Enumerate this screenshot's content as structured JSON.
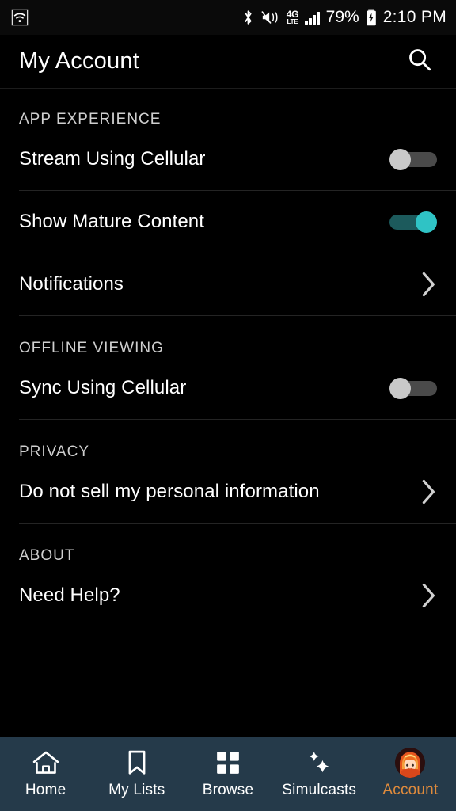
{
  "statusbar": {
    "wifi_icon": "wifi-icon",
    "bluetooth_icon": "bluetooth-icon",
    "mute_vibrate_icon": "speaker-mute-vibrate-icon",
    "network_label_top": "4G",
    "network_label_bottom": "LTE",
    "signal_icon": "signal-bars-icon",
    "battery_percent": "79%",
    "battery_icon": "battery-charging-icon",
    "time": "2:10 PM"
  },
  "header": {
    "title": "My Account",
    "search_icon": "search-icon"
  },
  "sections": [
    {
      "id": "app-experience",
      "title": "APP EXPERIENCE",
      "rows": [
        {
          "id": "stream-using-cellular",
          "label": "Stream Using Cellular",
          "control": "toggle",
          "value": "off",
          "divider": true
        },
        {
          "id": "show-mature-content",
          "label": "Show Mature Content",
          "control": "toggle",
          "value": "on",
          "divider": true
        },
        {
          "id": "notifications",
          "label": "Notifications",
          "control": "chevron",
          "value": "",
          "divider": true
        }
      ]
    },
    {
      "id": "offline-viewing",
      "title": "OFFLINE VIEWING",
      "rows": [
        {
          "id": "sync-using-cellular",
          "label": "Sync Using Cellular",
          "control": "toggle",
          "value": "off",
          "divider": true
        }
      ]
    },
    {
      "id": "privacy",
      "title": "PRIVACY",
      "rows": [
        {
          "id": "do-not-sell-my-personal-information",
          "label": "Do not sell my personal information",
          "control": "chevron",
          "value": "",
          "divider": true
        }
      ]
    },
    {
      "id": "about",
      "title": "ABOUT",
      "rows": [
        {
          "id": "need-help",
          "label": "Need Help?",
          "control": "chevron",
          "value": "",
          "divider": false
        }
      ]
    }
  ],
  "bottomnav": {
    "items": [
      {
        "id": "home",
        "label": "Home",
        "icon": "home-icon",
        "active": false
      },
      {
        "id": "my-lists",
        "label": "My Lists",
        "icon": "bookmark-icon",
        "active": false
      },
      {
        "id": "browse",
        "label": "Browse",
        "icon": "grid-icon",
        "active": false
      },
      {
        "id": "simulcasts",
        "label": "Simulcasts",
        "icon": "sparkles-icon",
        "active": false
      },
      {
        "id": "account",
        "label": "Account",
        "icon": "avatar-icon",
        "active": true
      }
    ]
  },
  "colors": {
    "background": "#000000",
    "toggle_on": "#2fc3c5",
    "toggle_on_track": "#1c5a5c",
    "toggle_off_knob": "#c9c9c9",
    "toggle_off_track": "#4a4a4a",
    "navbar_background": "#253a4a",
    "active_accent": "#e08b3c",
    "section_header": "#cfcfcf",
    "divider": "#242424"
  }
}
